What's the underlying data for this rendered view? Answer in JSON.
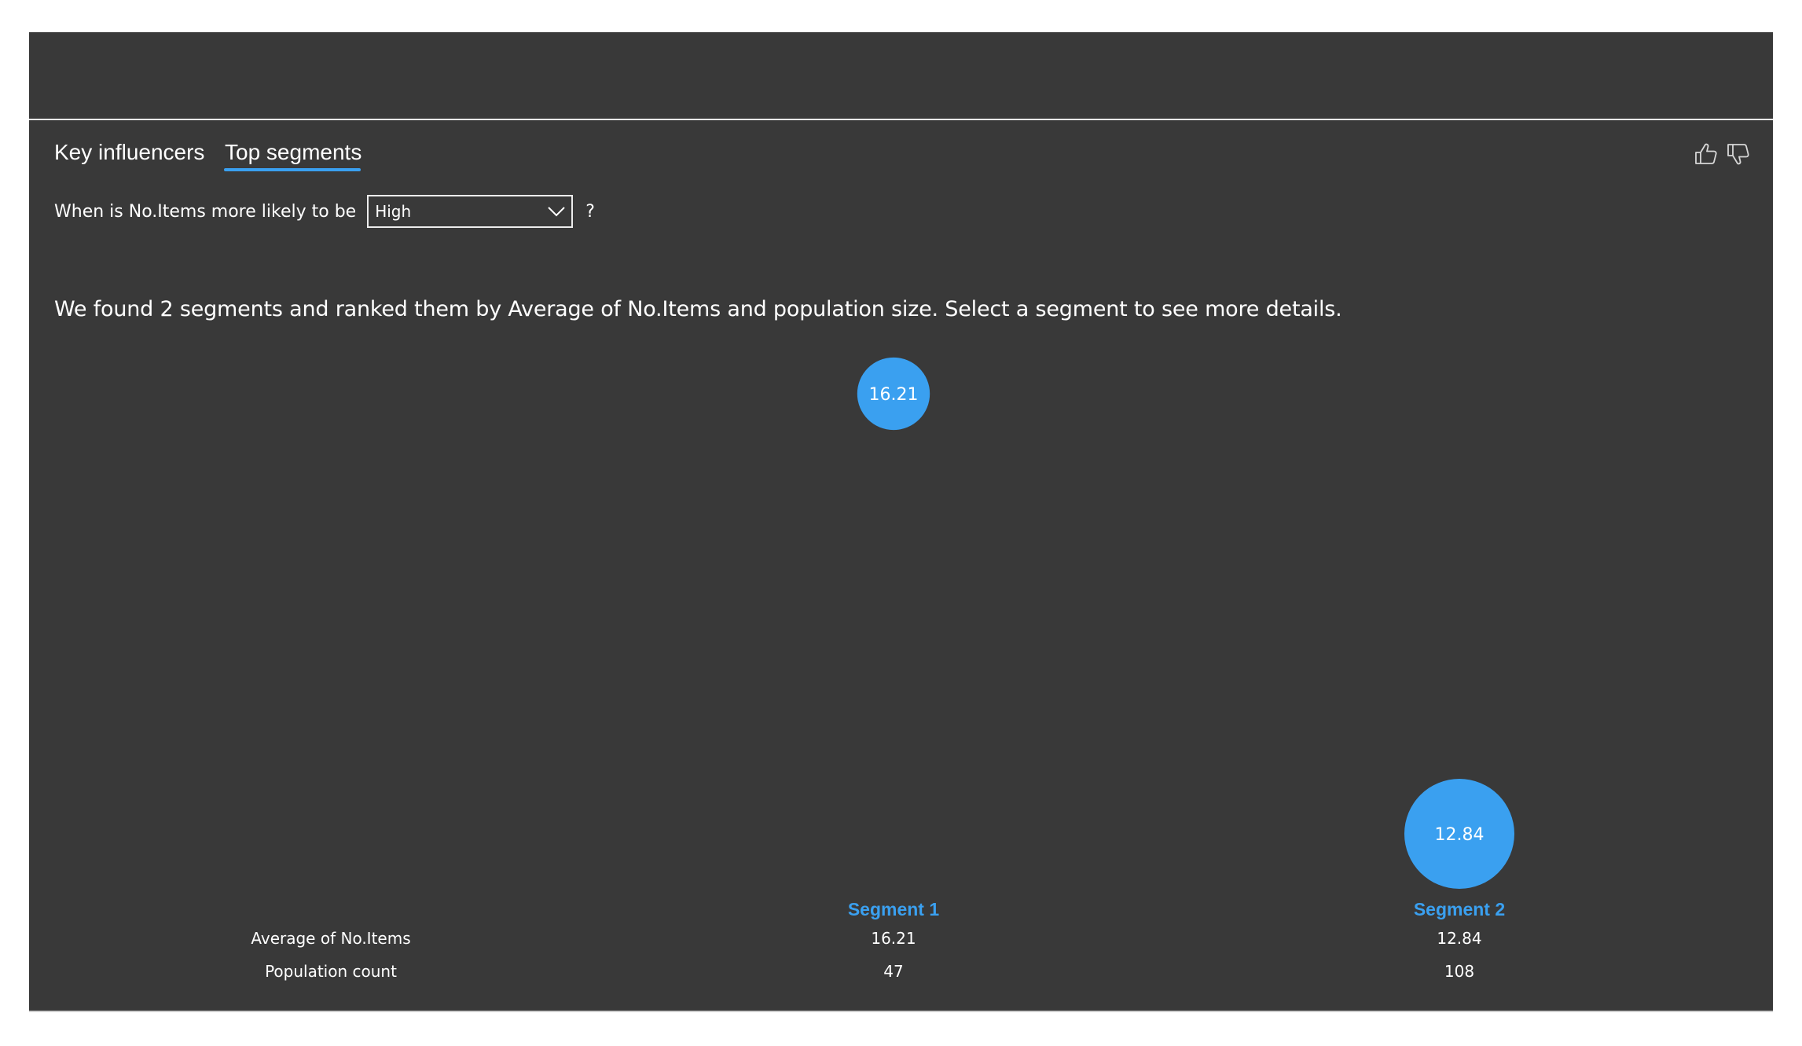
{
  "tabs": [
    {
      "label": "Key influencers",
      "active": false
    },
    {
      "label": "Top segments",
      "active": true
    }
  ],
  "feedback": {
    "thumbs_up_icon": "thumbs-up-icon",
    "thumbs_down_icon": "thumbs-down-icon"
  },
  "question": {
    "prefix": "When is No.Items more likely to be",
    "selected": "High",
    "suffix": "?"
  },
  "summary": "We found 2 segments and ranked them by Average of No.Items and population size. Select a segment to see more details.",
  "table": {
    "row_labels": [
      "Average of No.Items",
      "Population count"
    ]
  },
  "colors": {
    "accent": "#3aa0f0",
    "background": "#393939"
  },
  "chart_data": {
    "type": "scatter",
    "segments": [
      {
        "name": "Segment 1",
        "average": 16.21,
        "population": 47,
        "label": "16.21",
        "avg_text": "16.21",
        "pop_text": "47"
      },
      {
        "name": "Segment 2",
        "average": 12.84,
        "population": 108,
        "label": "12.84",
        "avg_text": "12.84",
        "pop_text": "108"
      }
    ]
  }
}
